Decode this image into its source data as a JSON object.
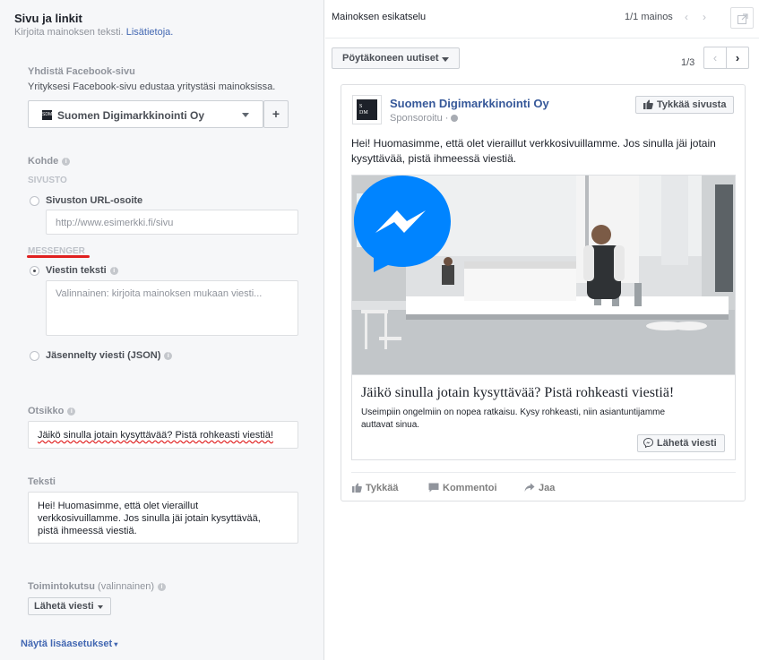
{
  "left": {
    "title": "Sivu ja linkit",
    "subtitle": "Kirjoita mainoksen teksti.",
    "subtitle_link": "Lisätietoja.",
    "connect_label": "Yhdistä Facebook-sivu",
    "connect_desc": "Yrityksesi Facebook-sivu edustaa yritystäsi mainoksissa.",
    "page_name": "Suomen Digimarkkinointi Oy",
    "add_button": "+",
    "target_label": "Kohde",
    "website_section": "SIVUSTO",
    "url_label": "Sivuston URL-osoite",
    "url_placeholder": "http://www.esimerkki.fi/sivu",
    "messenger_section": "MESSENGER",
    "message_label": "Viestin teksti",
    "message_placeholder": "Valinnainen: kirjoita mainoksen mukaan viesti...",
    "json_label": "Jäsennelty viesti (JSON)",
    "headline_label": "Otsikko",
    "headline_value": "Jäikö sinulla jotain kysyttävää? Pistä rohkeasti viestiä!",
    "text_label": "Teksti",
    "text_value_1": "Hei! Huomasimme, että olet vieraillut",
    "text_value_2": "verkkosivuillamme. Jos sinulla jäi jotain kysyttävää,",
    "text_value_3": "pistä ihmeessä viestiä.",
    "cta_label": "Toimintokutsu",
    "cta_optional": "(valinnainen)",
    "cta_value": "Lähetä viesti",
    "show_more": "Näytä lisäasetukset"
  },
  "right": {
    "title": "Mainoksen esikatselu",
    "ad_count": "1/1 mainos",
    "placement": "Pöytäkoneen uutiset",
    "pager": "1/3",
    "ad": {
      "page_name": "Suomen Digimarkkinointi Oy",
      "logo_text_1": "S",
      "logo_text_2": "DM",
      "sponsored": "Sponsoroitu ·",
      "like_page": "Tykkää sivusta",
      "body_1": "Hei! Huomasimme, että olet vieraillut verkkosivuillamme. Jos sinulla jäi jotain",
      "body_2": "kysyttävää, pistä ihmeessä viestiä.",
      "headline": "Jäikö sinulla jotain kysyttävää? Pistä rohkeasti viestiä!",
      "desc_1": "Useimpiin ongelmiin on nopea ratkaisu. Kysy rohkeasti, niin asiantuntijamme",
      "desc_2": "auttavat sinua.",
      "cta": "Lähetä viesti",
      "like": "Tykkää",
      "comment": "Kommentoi",
      "share": "Jaa"
    }
  },
  "colors": {
    "facebook_blue": "#4267b2",
    "messenger_blue": "#0084ff",
    "underline_red": "#e02020"
  }
}
